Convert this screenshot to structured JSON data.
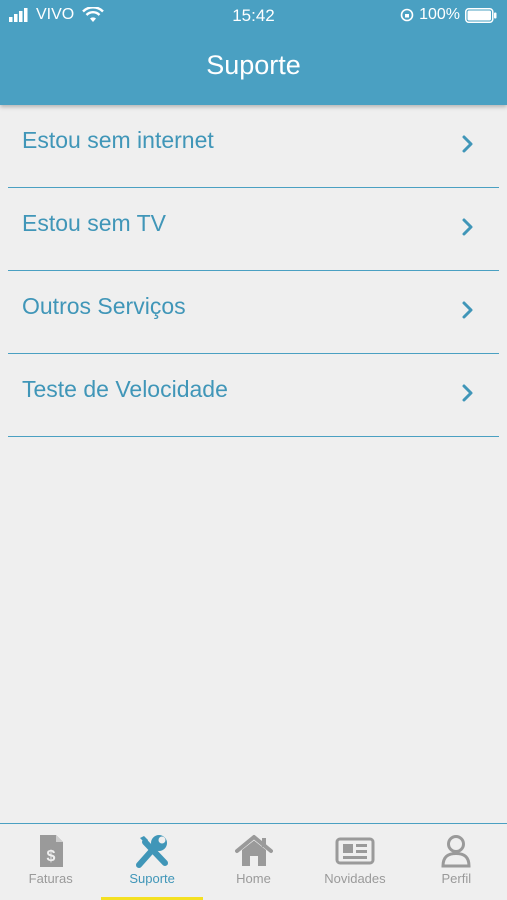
{
  "status_bar": {
    "carrier": "VIVO",
    "time": "15:42",
    "battery": "100%"
  },
  "header": {
    "title": "Suporte"
  },
  "menu": {
    "items": [
      {
        "label": "Estou sem internet"
      },
      {
        "label": "Estou sem TV"
      },
      {
        "label": "Outros Serviços"
      },
      {
        "label": "Teste de Velocidade"
      }
    ]
  },
  "tabbar": {
    "tabs": [
      {
        "label": "Faturas",
        "icon": "invoice-icon"
      },
      {
        "label": "Suporte",
        "icon": "tools-icon",
        "active": true
      },
      {
        "label": "Home",
        "icon": "home-icon"
      },
      {
        "label": "Novidades",
        "icon": "newspaper-icon"
      },
      {
        "label": "Perfil",
        "icon": "person-icon"
      }
    ]
  },
  "colors": {
    "primary": "#4aa0c2",
    "text_primary": "#4096b8",
    "active_underline": "#f4e022",
    "inactive": "#9a9a9a",
    "background": "#efefef"
  }
}
